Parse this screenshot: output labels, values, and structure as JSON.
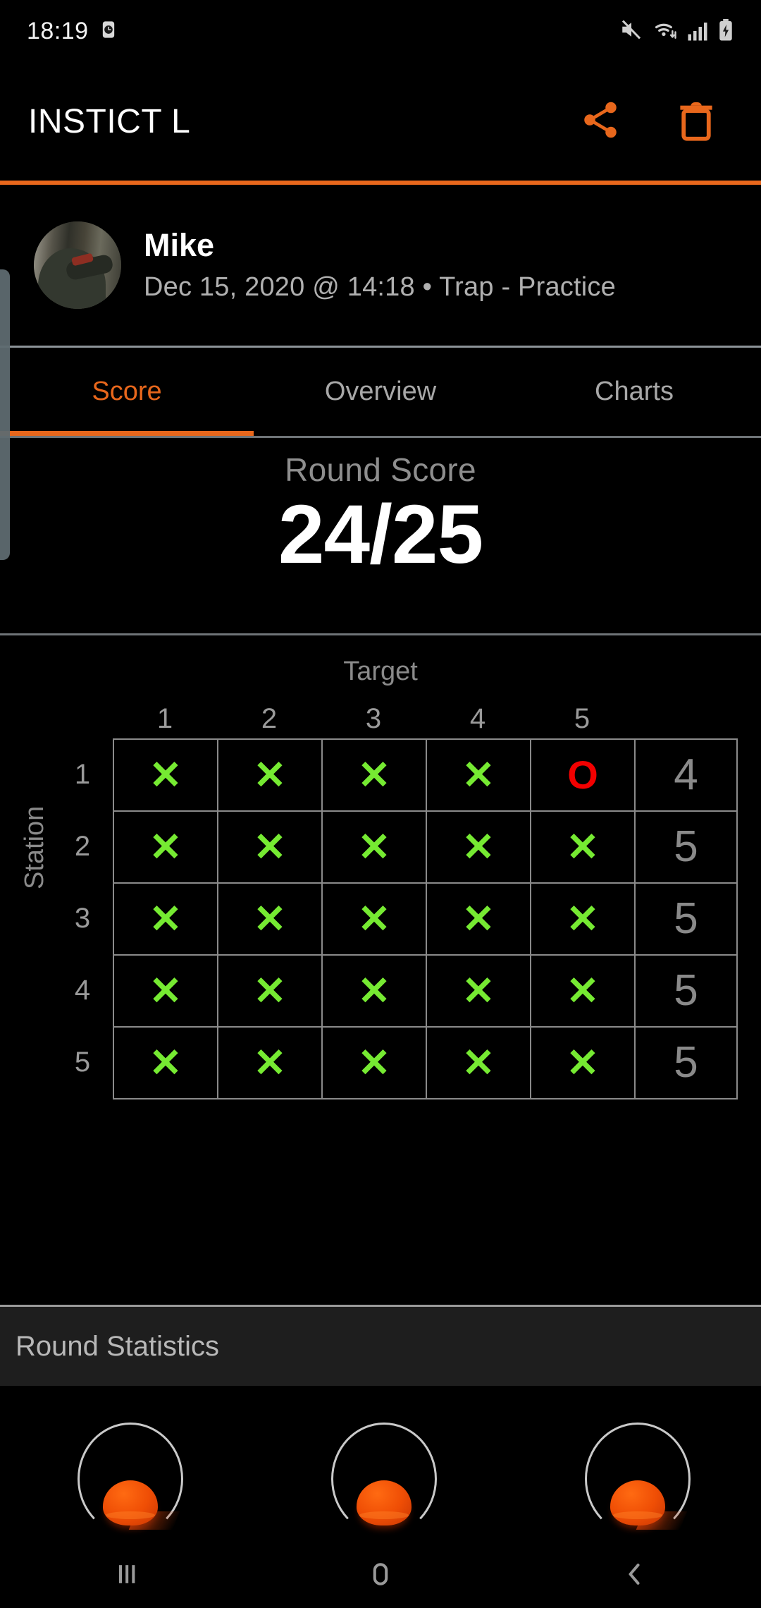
{
  "status_bar": {
    "time": "18:19",
    "icons": [
      "alarm-icon",
      "mute-icon",
      "wifi-icon",
      "signal-icon",
      "battery-charging-icon"
    ]
  },
  "app_bar": {
    "title": "INSTICT L",
    "actions": [
      {
        "name": "share-button",
        "icon": "share-icon"
      },
      {
        "name": "delete-button",
        "icon": "trash-icon"
      }
    ]
  },
  "profile": {
    "name": "Mike",
    "meta": "Dec 15, 2020 @ 14:18 • Trap - Practice"
  },
  "tabs": [
    {
      "label": "Score",
      "active": true
    },
    {
      "label": "Overview",
      "active": false
    },
    {
      "label": "Charts",
      "active": false
    }
  ],
  "round_score": {
    "label": "Round Score",
    "value": "24/25"
  },
  "scorecard": {
    "column_axis_label": "Target",
    "row_axis_label": "Station",
    "column_headers": [
      "1",
      "2",
      "3",
      "4",
      "5"
    ],
    "row_headers": [
      "1",
      "2",
      "3",
      "4",
      "5"
    ],
    "hit_glyph": "✕",
    "miss_glyph": "O",
    "rows": [
      {
        "station": "1",
        "marks": [
          "hit",
          "hit",
          "hit",
          "hit",
          "miss"
        ],
        "total": "4"
      },
      {
        "station": "2",
        "marks": [
          "hit",
          "hit",
          "hit",
          "hit",
          "hit"
        ],
        "total": "5"
      },
      {
        "station": "3",
        "marks": [
          "hit",
          "hit",
          "hit",
          "hit",
          "hit"
        ],
        "total": "5"
      },
      {
        "station": "4",
        "marks": [
          "hit",
          "hit",
          "hit",
          "hit",
          "hit"
        ],
        "total": "5"
      },
      {
        "station": "5",
        "marks": [
          "hit",
          "hit",
          "hit",
          "hit",
          "hit"
        ],
        "total": "5"
      }
    ]
  },
  "round_statistics": {
    "title": "Round Statistics",
    "clay_items": [
      "clay-target-icon",
      "clay-target-icon",
      "clay-target-icon"
    ]
  },
  "nav_bar": {
    "buttons": [
      {
        "name": "recents-button",
        "icon": "recents-icon"
      },
      {
        "name": "home-button",
        "icon": "home-icon"
      },
      {
        "name": "back-button",
        "icon": "back-icon"
      }
    ]
  },
  "colors": {
    "accent": "#e8671c",
    "hit": "#76ea32",
    "miss": "#f20000",
    "background": "#000000",
    "muted_text": "#8a8a8a",
    "stats_bar": "#1e1e1e"
  }
}
